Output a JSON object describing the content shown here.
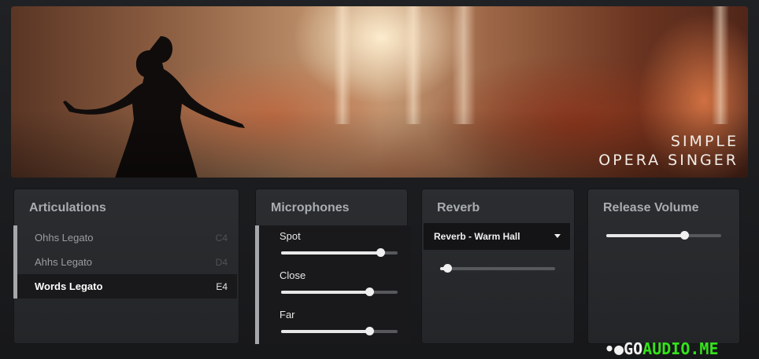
{
  "banner": {
    "brand_line1": "SIMPLE",
    "brand_line2": "OPERA SINGER"
  },
  "articulations": {
    "title": "Articulations",
    "items": [
      {
        "label": "Ohhs Legato",
        "key": "C4",
        "active": false
      },
      {
        "label": "Ahhs Legato",
        "key": "D4",
        "active": false
      },
      {
        "label": "Words Legato",
        "key": "E4",
        "active": true
      }
    ]
  },
  "microphones": {
    "title": "Microphones",
    "items": [
      {
        "label": "Spot",
        "level": 0.85
      },
      {
        "label": "Close",
        "level": 0.76
      },
      {
        "label": "Far",
        "level": 0.76
      }
    ]
  },
  "reverb": {
    "title": "Reverb",
    "preset": "Reverb - Warm Hall",
    "level": 0.06
  },
  "release_volume": {
    "title": "Release Volume",
    "level": 0.68
  },
  "watermark": {
    "part1": "•●GO",
    "part2": "AUDIO.ME"
  },
  "colors": {
    "background": "#1b1c1e",
    "panel": "#2b2d30",
    "accent_bar": "#a5a7aa",
    "watermark_green": "#34e31a"
  }
}
